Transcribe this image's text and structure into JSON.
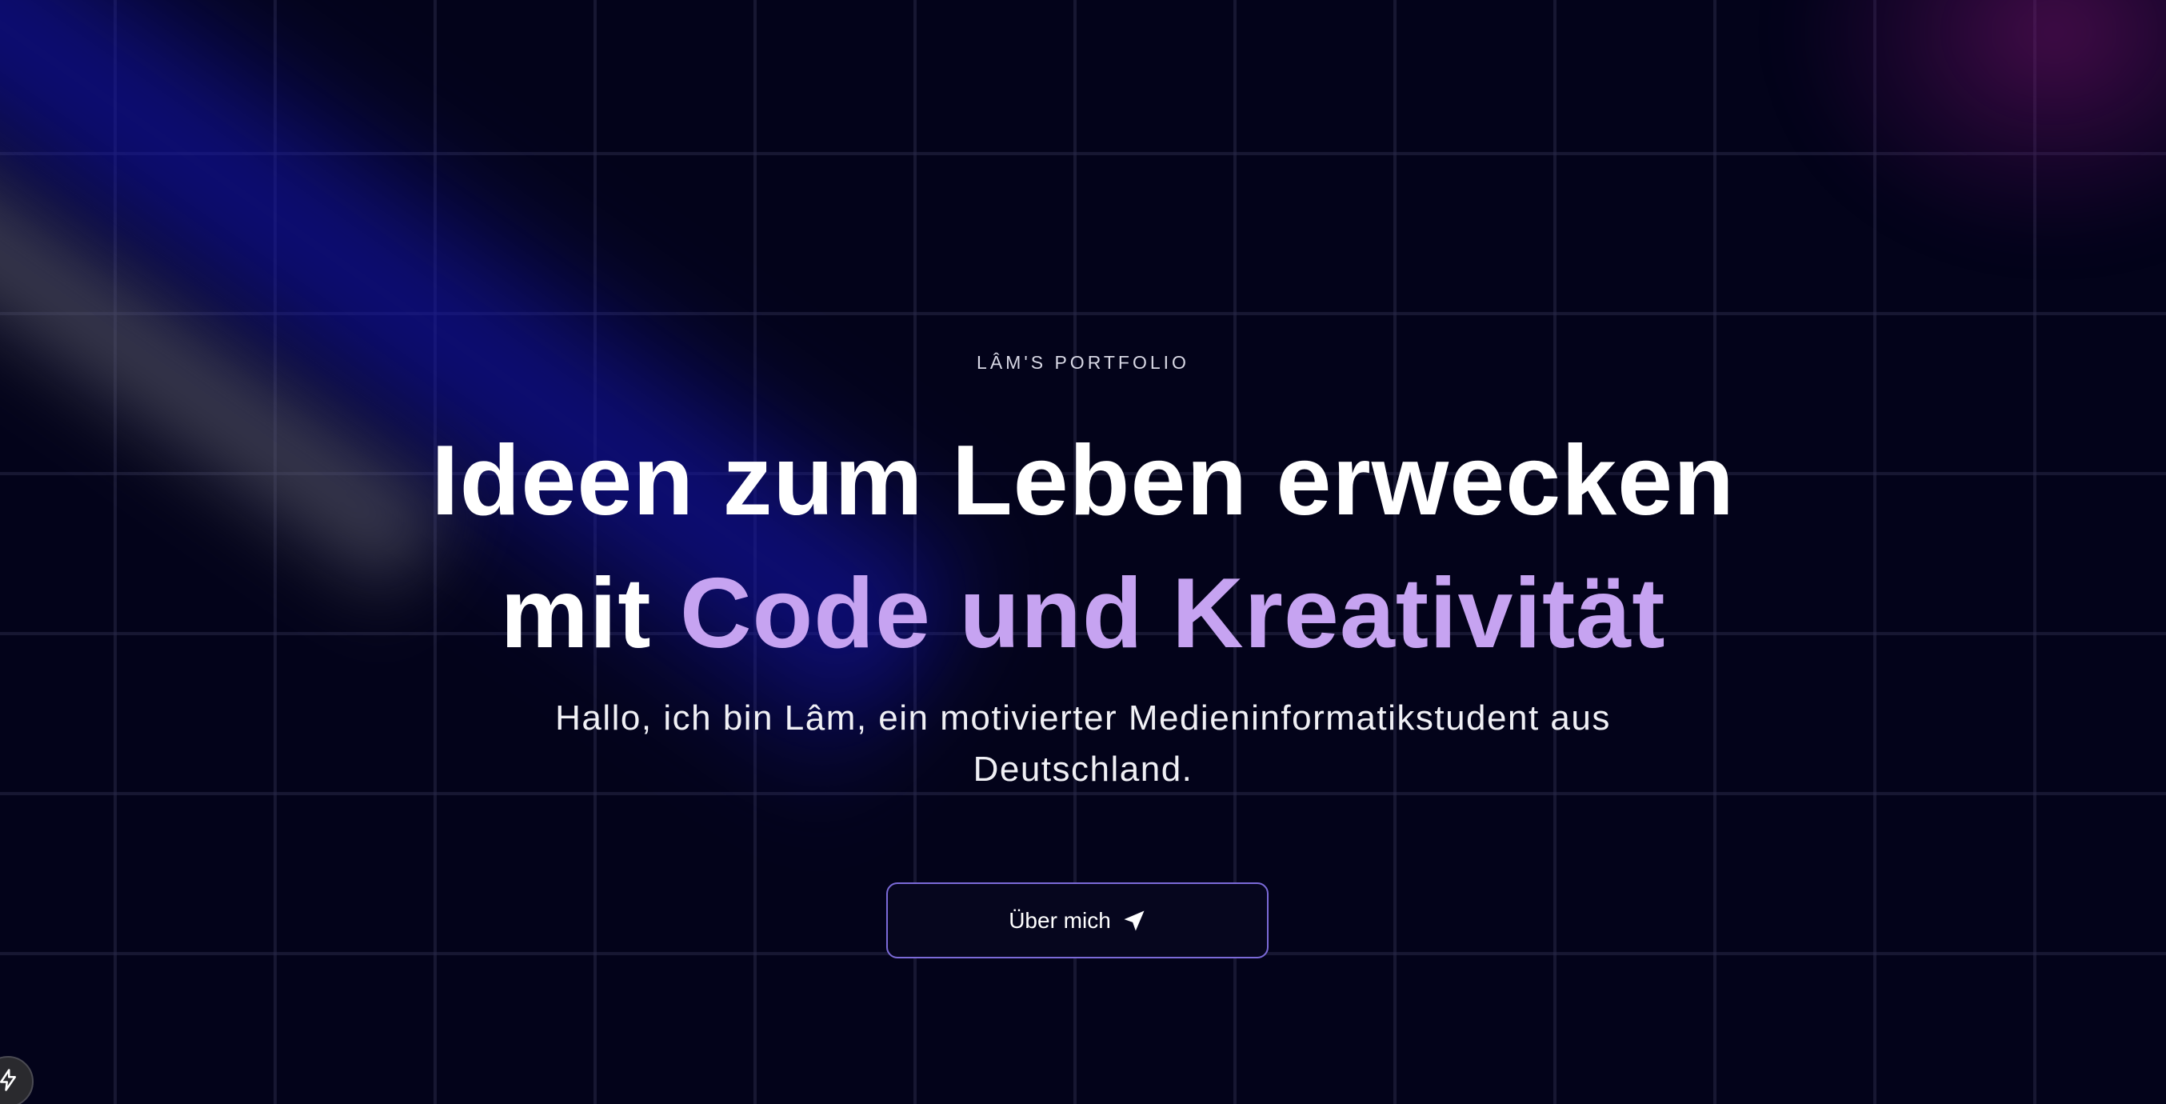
{
  "hero": {
    "eyebrow": "LÂM'S PORTFOLIO",
    "headline_line1": "Ideen zum Leben erwecken",
    "headline_line2_prefix": "mit ",
    "headline_line2_accent": "Code und Kreativität",
    "intro": "Hallo, ich bin Lâm, ein motivierter Medieninformatikstudent aus Deutschland."
  },
  "cta": {
    "label": "Über mich",
    "icon": "paper-plane-icon"
  },
  "badge": {
    "icon": "bolt-icon"
  },
  "colors": {
    "background": "#03031a",
    "accent": "#c6a3f1",
    "button_border": "#7b6ad8"
  }
}
